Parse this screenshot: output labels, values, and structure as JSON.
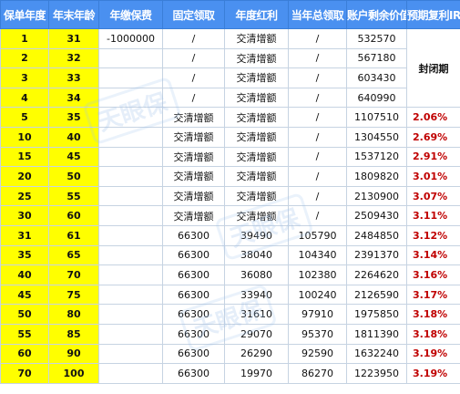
{
  "headers": [
    "保单年度",
    "年末年龄",
    "年缴保费",
    "固定领取",
    "年度红利",
    "当年总领取",
    "账户剩余价值",
    "预期复利IRR"
  ],
  "sealed_label": "封闭期",
  "watermark": "天眼保",
  "rows": [
    {
      "year": "1",
      "age": "31",
      "premium": "-1000000",
      "fixed": "/",
      "bonus": "交清增额",
      "total": "/",
      "value": "532570",
      "irr": ""
    },
    {
      "year": "2",
      "age": "32",
      "premium": "",
      "fixed": "/",
      "bonus": "交清增额",
      "total": "/",
      "value": "567180",
      "irr": ""
    },
    {
      "year": "3",
      "age": "33",
      "premium": "",
      "fixed": "/",
      "bonus": "交清增额",
      "total": "/",
      "value": "603430",
      "irr": ""
    },
    {
      "year": "4",
      "age": "34",
      "premium": "",
      "fixed": "/",
      "bonus": "交清增额",
      "total": "/",
      "value": "640990",
      "irr": ""
    },
    {
      "year": "5",
      "age": "35",
      "premium": "",
      "fixed": "交清增额",
      "bonus": "交清增额",
      "total": "/",
      "value": "1107510",
      "irr": "2.06%"
    },
    {
      "year": "10",
      "age": "40",
      "premium": "",
      "fixed": "交清增额",
      "bonus": "交清增额",
      "total": "/",
      "value": "1304550",
      "irr": "2.69%"
    },
    {
      "year": "15",
      "age": "45",
      "premium": "",
      "fixed": "交清增额",
      "bonus": "交清增额",
      "total": "/",
      "value": "1537120",
      "irr": "2.91%"
    },
    {
      "year": "20",
      "age": "50",
      "premium": "",
      "fixed": "交清增额",
      "bonus": "交清增额",
      "total": "/",
      "value": "1809820",
      "irr": "3.01%"
    },
    {
      "year": "25",
      "age": "55",
      "premium": "",
      "fixed": "交清增额",
      "bonus": "交清增额",
      "total": "/",
      "value": "2130900",
      "irr": "3.07%"
    },
    {
      "year": "30",
      "age": "60",
      "premium": "",
      "fixed": "交清增额",
      "bonus": "交清增额",
      "total": "/",
      "value": "2509430",
      "irr": "3.11%"
    },
    {
      "year": "31",
      "age": "61",
      "premium": "",
      "fixed": "66300",
      "bonus": "39490",
      "total": "105790",
      "value": "2484850",
      "irr": "3.12%"
    },
    {
      "year": "35",
      "age": "65",
      "premium": "",
      "fixed": "66300",
      "bonus": "38040",
      "total": "104340",
      "value": "2391370",
      "irr": "3.14%"
    },
    {
      "year": "40",
      "age": "70",
      "premium": "",
      "fixed": "66300",
      "bonus": "36080",
      "total": "102380",
      "value": "2264620",
      "irr": "3.16%"
    },
    {
      "year": "45",
      "age": "75",
      "premium": "",
      "fixed": "66300",
      "bonus": "33940",
      "total": "100240",
      "value": "2126590",
      "irr": "3.17%"
    },
    {
      "year": "50",
      "age": "80",
      "premium": "",
      "fixed": "66300",
      "bonus": "31610",
      "total": "97910",
      "value": "1975850",
      "irr": "3.18%"
    },
    {
      "year": "55",
      "age": "85",
      "premium": "",
      "fixed": "66300",
      "bonus": "29070",
      "total": "95370",
      "value": "1811390",
      "irr": "3.18%"
    },
    {
      "year": "60",
      "age": "90",
      "premium": "",
      "fixed": "66300",
      "bonus": "26290",
      "total": "92590",
      "value": "1632240",
      "irr": "3.19%"
    },
    {
      "year": "70",
      "age": "100",
      "premium": "",
      "fixed": "66300",
      "bonus": "19970",
      "total": "86270",
      "value": "1223950",
      "irr": "3.19%"
    }
  ]
}
